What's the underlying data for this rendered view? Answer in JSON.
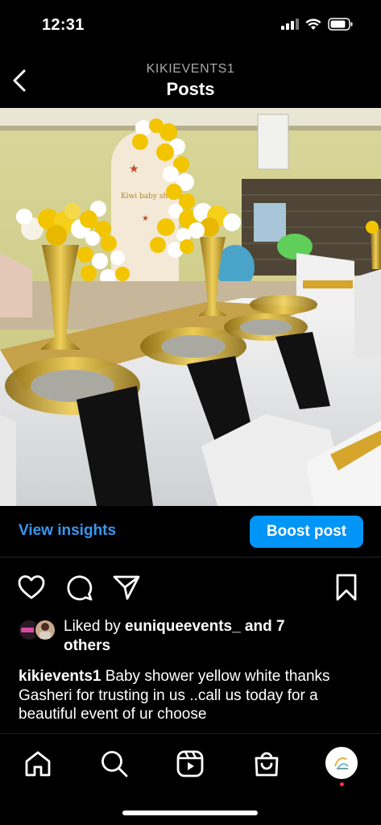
{
  "status_bar": {
    "time": "12:31"
  },
  "header": {
    "username": "KIKIEVENTS1",
    "title": "Posts"
  },
  "insights": {
    "view_label": "View insights",
    "boost_label": "Boost post"
  },
  "likes": {
    "prefix": "Liked by ",
    "user": "euniqueevents_",
    "suffix": " and 7 others"
  },
  "caption": {
    "username": "kikievents1",
    "text": " Baby shower yellow white thanks Gasheri for trusting in us ..call us today for a beautiful event of ur choose"
  },
  "backdrop_text": "Kiwi baby shower",
  "colors": {
    "accent_blue": "#0095f6",
    "link_blue": "#3897f0",
    "notif_red": "#ff3040",
    "balloon_yellow": "#f2c500"
  },
  "icons": [
    "back-icon",
    "heart-icon",
    "comment-icon",
    "share-icon",
    "bookmark-icon",
    "home-icon",
    "search-icon",
    "reels-icon",
    "shop-icon",
    "profile-avatar"
  ]
}
